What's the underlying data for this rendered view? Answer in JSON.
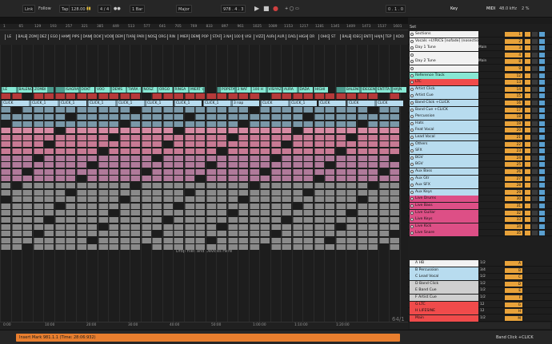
{
  "toolbar": {
    "link": "Link",
    "follow": "Follow",
    "tap": "Tap",
    "bpm": "128.00",
    "sig": "4 / 4",
    "quant": "1 Bar",
    "key": "Major",
    "pos": "978 . 4 . 3",
    "pos2": "0 . 1 . 0",
    "midi_key": "Key",
    "midi": "MIDI",
    "rate": "48.0 kHz",
    "cpu": "2 %"
  },
  "ruler_nums": [
    "1",
    "65",
    "129",
    "193",
    "257",
    "321",
    "385",
    "449",
    "513",
    "577",
    "641",
    "705",
    "769",
    "833",
    "897",
    "961",
    "1025",
    "1089",
    "1153",
    "1217",
    "1281",
    "1345",
    "1409",
    "1473",
    "1537",
    "1601"
  ],
  "markers": [
    "LE",
    "BALENCIAG",
    "ZOMBI",
    "DEZ",
    "EGO",
    "HAMURE",
    "PIPS",
    "DANCIN",
    "DOKT",
    "VOODE",
    "DEMS",
    "TIARA",
    "PARI",
    "NOSZ",
    "ORGON",
    "RIN",
    "MIERT",
    "DEMENT",
    "POP",
    "STAF",
    "3 NAP",
    "100 H",
    "VISI",
    "VIZZI",
    "AURA",
    "AUR",
    "DADA",
    "HIGHS",
    "DR",
    "OHIG",
    "ST",
    "BALENCI",
    "IDEGEN",
    "ENTITA",
    "HAJNAL",
    "TEP",
    "KOOK"
  ],
  "sections_header": "Set",
  "tracks": [
    {
      "name": "Sections",
      "num": "1",
      "color": "#f2f2f2",
      "lane": "#2b2b2b"
    },
    {
      "name": "Vocals +LYRICS [nofade] (nosection",
      "num": "2",
      "color": "#f2f2f2",
      "lane": "#2b2b2b"
    },
    {
      "name": "Day 1 Tune",
      "num": "3",
      "color": "#f2f2f2",
      "lane": "#2b2b2b",
      "extra": "Main"
    },
    {
      "name": "",
      "num": "4",
      "color": "#f2f2f2",
      "lane": "#2b2b2b"
    },
    {
      "name": "Day 2 Tune",
      "num": "8",
      "color": "#f2f2f2",
      "lane": "#2b2b2b",
      "extra": "Main"
    },
    {
      "name": "",
      "num": "9",
      "color": "#f2f2f2",
      "lane": "#2b2b2b"
    },
    {
      "name": "Reference Track",
      "num": "12",
      "color": "#87e8d4",
      "lane": "#4c9c8e"
    },
    {
      "name": "LTC",
      "num": "13",
      "color": "#f04b4b",
      "lane": "#b53a3a"
    },
    {
      "name": "Artist Click",
      "num": "14",
      "color": "#b8dcef",
      "lane": "#7a98a8"
    },
    {
      "name": "Artist Cue",
      "num": "15",
      "color": "#b8dcef",
      "lane": "#7a98a8"
    },
    {
      "name": "Band Click +CLICK",
      "num": "16",
      "color": "#b8dcef",
      "lane": "#7a98a8"
    },
    {
      "name": "Band Cue +CLICK",
      "num": "17",
      "color": "#b8dcef",
      "lane": "#7a98a8"
    },
    {
      "name": "Percussion",
      "num": "18",
      "color": "#b8dcef",
      "lane": "#d58aa2"
    },
    {
      "name": "Hats",
      "num": "19",
      "color": "#b8dcef",
      "lane": "#c87a94"
    },
    {
      "name": "Feat Vocal",
      "num": "20",
      "color": "#b8dcef",
      "lane": "#c87a94"
    },
    {
      "name": "Lead Vocal",
      "num": "21",
      "color": "#b8dcef",
      "lane": "#c87a94"
    },
    {
      "name": "Others",
      "num": "22",
      "color": "#b8dcef",
      "lane": "#b07a9a"
    },
    {
      "name": "SFX",
      "num": "23",
      "color": "#b8dcef",
      "lane": "#b07a9a"
    },
    {
      "name": "BGV",
      "num": "24",
      "color": "#b8dcef",
      "lane": "#b07a9a"
    },
    {
      "name": "BGV",
      "num": "25",
      "color": "#b8dcef",
      "lane": "#b07a9a"
    },
    {
      "name": "Aux Bass",
      "num": "26",
      "color": "#b8dcef",
      "lane": "#8a8a8a"
    },
    {
      "name": "Aux Gtr",
      "num": "27",
      "color": "#b8dcef",
      "lane": "#8a8a8a"
    },
    {
      "name": "Aux SFX",
      "num": "28",
      "color": "#b8dcef",
      "lane": "#8a8a8a"
    },
    {
      "name": "Aux Keys",
      "num": "29",
      "color": "#b8dcef",
      "lane": "#8a8a8a"
    },
    {
      "name": "Live Drums",
      "num": "30",
      "color": "#dd4f86",
      "lane": "#8a8a8a"
    },
    {
      "name": "Live Bass",
      "num": "31",
      "color": "#dd4f86",
      "lane": "#8a8a8a"
    },
    {
      "name": "Live Guitar",
      "num": "32",
      "color": "#dd4f86",
      "lane": "#8a8a8a"
    },
    {
      "name": "Live Keys",
      "num": "33",
      "color": "#dd4f86",
      "lane": "#8a8a8a"
    },
    {
      "name": "Live Kick",
      "num": "34",
      "color": "#dd4f86",
      "lane": "#8a8a8a"
    },
    {
      "name": "Live Snare",
      "num": "35",
      "color": "#dd4f86",
      "lane": "#8a8a8a"
    }
  ],
  "returns": [
    {
      "name": "A HB",
      "num": "A",
      "color": "#f2f2f2",
      "route": "1/2"
    },
    {
      "name": "B Percussion",
      "num": "B",
      "color": "#b8dcef",
      "route": "3/4"
    },
    {
      "name": "C Lead Vocal",
      "num": "C",
      "color": "#b8dcef",
      "route": "1/2"
    },
    {
      "name": "D Band Click",
      "num": "D",
      "color": "#cfcfcf",
      "route": "1/2"
    },
    {
      "name": "E Band Cue",
      "num": "E",
      "color": "#cfcfcf",
      "route": "1/2"
    },
    {
      "name": "F Artist Cue",
      "num": "F",
      "color": "#cfcfcf",
      "route": "1/2"
    },
    {
      "name": "G LTC",
      "num": "G",
      "color": "#f04b4b",
      "route": "12"
    },
    {
      "name": "H LIFESINE",
      "num": "H",
      "color": "#f04b4b",
      "route": "12"
    },
    {
      "name": "Main",
      "num": "M",
      "color": "#f04b4b",
      "route": "1/2"
    }
  ],
  "drop_text": "Drop Files and Devices Here",
  "lane_labels": [
    "LE",
    "BALENCIAG",
    "ZOMBI - IDEGE",
    "",
    "ISAGRA",
    "DOKT",
    "VOO",
    "DEMS",
    "TIARA - PA",
    "NOSZ",
    "ORGO",
    "RINGA",
    "MIERT VC",
    "",
    "POPSTA",
    "3 NAF",
    "100 H",
    "VISIYAZ",
    "AURA",
    "DADA",
    "HIGHI",
    "",
    "BALENCIA",
    "IDEGEN",
    "ENTITA",
    "HAJN"
  ],
  "click_labels": [
    "CLICK",
    "CLICK_1",
    "CLICK_1",
    "CLICK_1",
    "CLICK_1",
    "CLICK_1",
    "CLICK_1",
    "CLICK_1",
    "3 nap",
    "CLICK",
    "CLICK_1",
    "CLICK",
    "CLICK",
    "CLICK"
  ],
  "time_labels": [
    "0:00",
    "10:00",
    "20:00",
    "30:00",
    "40:00",
    "50:00",
    "1:00:00",
    "1:10:00",
    "1:20:00"
  ],
  "status_msg": "Insert Mark 981.1.1 (Time: 28:06:932)",
  "status_right": "Band Click +CLICK",
  "page_num": "64/1"
}
